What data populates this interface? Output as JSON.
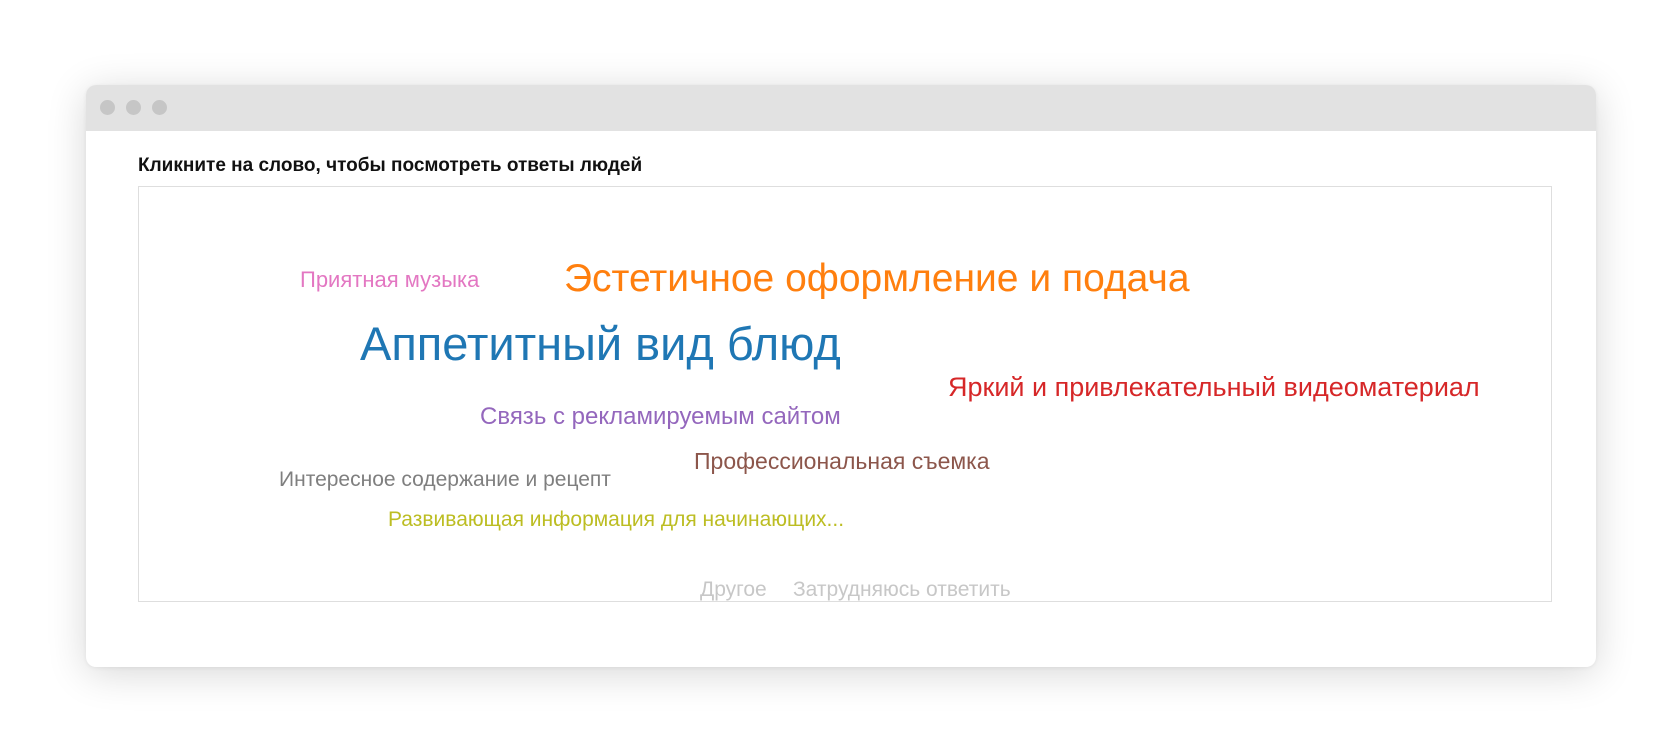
{
  "window": {
    "controls": [
      "window-close-dot",
      "window-minimize-dot",
      "window-maximize-dot"
    ]
  },
  "prompt": "Кликните на слово, чтобы посмотреть ответы людей",
  "cloud": {
    "words": [
      {
        "id": "music",
        "text": "Приятная музыка",
        "color": "#e377c2"
      },
      {
        "id": "aesth",
        "text": "Эстетичное оформление и подача",
        "color": "#ff7f0e"
      },
      {
        "id": "app",
        "text": "Аппетитный вид блюд",
        "color": "#1f77b4"
      },
      {
        "id": "bright",
        "text": "Яркий и привлекательный видеоматериал",
        "color": "#d62728"
      },
      {
        "id": "link",
        "text": "Связь с рекламируемым сайтом",
        "color": "#9467bd"
      },
      {
        "id": "prof",
        "text": "Профессиональная съемка",
        "color": "#8c564b"
      },
      {
        "id": "interest",
        "text": "Интересное содержание и рецепт",
        "color": "#7f7f7f"
      },
      {
        "id": "dev",
        "text": "Развивающая информация для начинающих...",
        "color": "#bcbd22"
      },
      {
        "id": "other",
        "text": "Другое",
        "color": "#c7c7c7"
      },
      {
        "id": "hard",
        "text": "Затрудняюсь ответить",
        "color": "#c7c7c7"
      }
    ]
  }
}
